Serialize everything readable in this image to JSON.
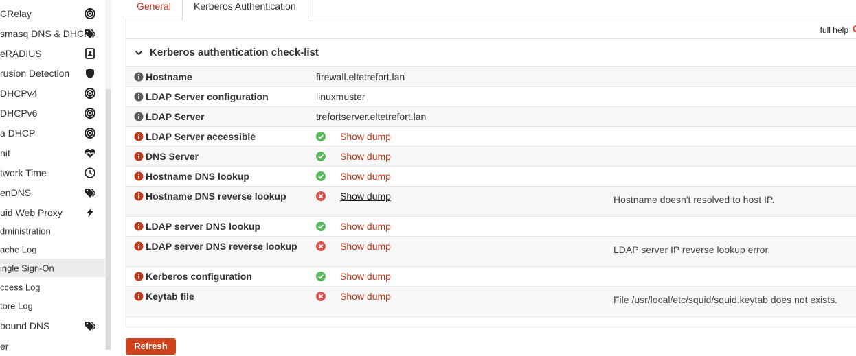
{
  "sidebar": {
    "items": [
      {
        "label": "CRelay",
        "icon": "target-icon"
      },
      {
        "label": "smasq DNS & DHCP",
        "icon": "tags-icon"
      },
      {
        "label": "eRADIUS",
        "icon": "id-card-icon"
      },
      {
        "label": "rusion Detection",
        "icon": "shield-icon"
      },
      {
        "label": "DHCPv4",
        "icon": "target-icon"
      },
      {
        "label": "DHCPv6",
        "icon": "target-icon"
      },
      {
        "label": "a DHCP",
        "icon": "target-icon"
      },
      {
        "label": "nit",
        "icon": "heartbeat-icon"
      },
      {
        "label": "twork Time",
        "icon": "clock-icon"
      },
      {
        "label": "enDNS",
        "icon": "tags-icon"
      },
      {
        "label": "uid Web Proxy",
        "icon": "bolt-icon"
      },
      {
        "label": "dministration",
        "icon": ""
      },
      {
        "label": "ache Log",
        "icon": ""
      },
      {
        "label": "ingle Sign-On",
        "icon": "",
        "active": true
      },
      {
        "label": "ccess Log",
        "icon": ""
      },
      {
        "label": "tore Log",
        "icon": ""
      },
      {
        "label": "bound DNS",
        "icon": "tags-icon"
      },
      {
        "label": "er",
        "icon": ""
      }
    ]
  },
  "tabs": {
    "general": "General",
    "kerberos": "Kerberos Authentication"
  },
  "help": {
    "full_help": "full help"
  },
  "section": {
    "title": "Kerberos authentication check-list"
  },
  "rows": [
    {
      "label": "Hostname",
      "value": "firewall.eltetrefort.lan"
    },
    {
      "label": "LDAP Server configuration",
      "value": "linuxmuster"
    },
    {
      "label": "LDAP Server",
      "value": "trefortserver.eltetrefort.lan"
    },
    {
      "label": "LDAP Server accessible",
      "status": "ok",
      "link": "Show dump"
    },
    {
      "label": "DNS Server",
      "status": "ok",
      "link": "Show dump"
    },
    {
      "label": "Hostname DNS lookup",
      "status": "ok",
      "link": "Show dump"
    },
    {
      "label": "Hostname DNS reverse lookup",
      "status": "error",
      "link": "Show dump",
      "message": "Hostname doesn't resolved to host IP."
    },
    {
      "label": "LDAP server DNS lookup",
      "status": "ok",
      "link": "Show dump"
    },
    {
      "label": "LDAP server DNS reverse lookup",
      "status": "error",
      "link": "Show dump",
      "message": "LDAP server IP reverse lookup error."
    },
    {
      "label": "Kerberos configuration",
      "status": "ok",
      "link": "Show dump"
    },
    {
      "label": "Keytab file",
      "status": "error",
      "link": "Show dump",
      "message": "File /usr/local/etc/squid/squid.keytab does not exists."
    }
  ],
  "actions": {
    "refresh": "Refresh"
  },
  "colors": {
    "accent": "#c0391b",
    "ok": "#5cb85c",
    "error": "#d9534f",
    "info_icon": "#c0391b",
    "info_icon_gray": "#5b5b5b"
  }
}
